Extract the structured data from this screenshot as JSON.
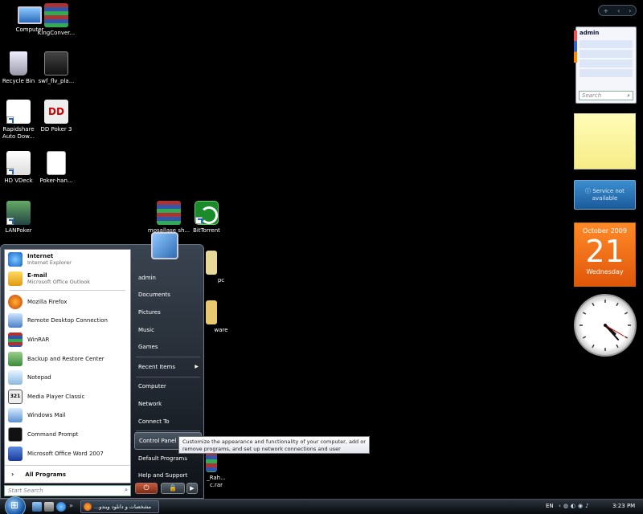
{
  "desktop_icons": [
    {
      "label": "Computer",
      "icon": "computer-icon"
    },
    {
      "label": "KingConver...",
      "icon": "winrar-archive-icon"
    },
    {
      "label": "Recycle Bin",
      "icon": "recycle-bin-icon"
    },
    {
      "label": "swf_flv_pla...",
      "icon": "swf-player-icon"
    },
    {
      "label": "Rapidshare Auto Dow...",
      "icon": "rapidshare-icon"
    },
    {
      "label": "DD Poker 3",
      "icon": "dd-poker-icon"
    },
    {
      "label": "HD VDeck",
      "icon": "hd-vdeck-icon"
    },
    {
      "label": "Poker-han...",
      "icon": "document-icon"
    },
    {
      "label": "LANPoker",
      "icon": "lanpoker-icon"
    },
    {
      "label": "mosallase sh...",
      "icon": "winrar-archive-icon"
    },
    {
      "label": "BitTorrent",
      "icon": "bittorrent-icon"
    },
    {
      "label": "pc",
      "icon": "folder-icon"
    },
    {
      "label": "ware",
      "icon": "folder-icon"
    },
    {
      "label": "_Rah... c.rar",
      "icon": "winrar-archive-icon"
    }
  ],
  "sidebar": {
    "controls": [
      "+",
      "‹",
      "›"
    ],
    "contacts": {
      "name": "admin",
      "search_placeholder": "Search"
    },
    "feed": {
      "line1": "Service not",
      "line2": "available"
    },
    "calendar": {
      "month": "October 2009",
      "day": "21",
      "weekday": "Wednesday"
    },
    "clock": {
      "hour": 4,
      "minute": 23,
      "second": 20
    }
  },
  "start_menu": {
    "pinned": [
      {
        "title": "Internet",
        "subtitle": "Internet Explorer",
        "icon": "internet-explorer-icon"
      },
      {
        "title": "E-mail",
        "subtitle": "Microsoft Office Outlook",
        "icon": "outlook-icon"
      }
    ],
    "recent": [
      {
        "label": "Mozilla Firefox",
        "icon": "firefox-icon"
      },
      {
        "label": "Remote Desktop Connection",
        "icon": "remote-desktop-icon"
      },
      {
        "label": "WinRAR",
        "icon": "winrar-icon"
      },
      {
        "label": "Backup and Restore Center",
        "icon": "backup-icon"
      },
      {
        "label": "Notepad",
        "icon": "notepad-icon"
      },
      {
        "label": "Media Player Classic",
        "icon": "media-player-icon"
      },
      {
        "label": "Windows Mail",
        "icon": "windows-mail-icon"
      },
      {
        "label": "Command Prompt",
        "icon": "command-prompt-icon"
      },
      {
        "label": "Microsoft Office Word 2007",
        "icon": "word-icon"
      }
    ],
    "all_programs": "All Programs",
    "search_placeholder": "Start Search",
    "right_items": [
      {
        "label": "admin"
      },
      {
        "label": "Documents"
      },
      {
        "label": "Pictures"
      },
      {
        "label": "Music"
      },
      {
        "label": "Games"
      },
      {
        "label": "Recent Items",
        "submenu": true
      },
      {
        "label": "Computer"
      },
      {
        "label": "Network"
      },
      {
        "label": "Connect To"
      },
      {
        "label": "Control Panel",
        "highlighted": true
      },
      {
        "label": "Default Programs"
      },
      {
        "label": "Help and Support"
      }
    ],
    "tooltip": "Customize the appearance and functionality of your computer, add or remove programs, and set up network connections and user accounts."
  },
  "taskbar": {
    "task_label": "...مشخصات و دانلود ویندو",
    "language": "EN",
    "time": "3:23 PM"
  },
  "colors": {
    "calendar_orange": "#f07020",
    "note_yellow": "#fbf4a0",
    "feed_blue": "#2a74b8",
    "highlight": "#4d5866"
  }
}
